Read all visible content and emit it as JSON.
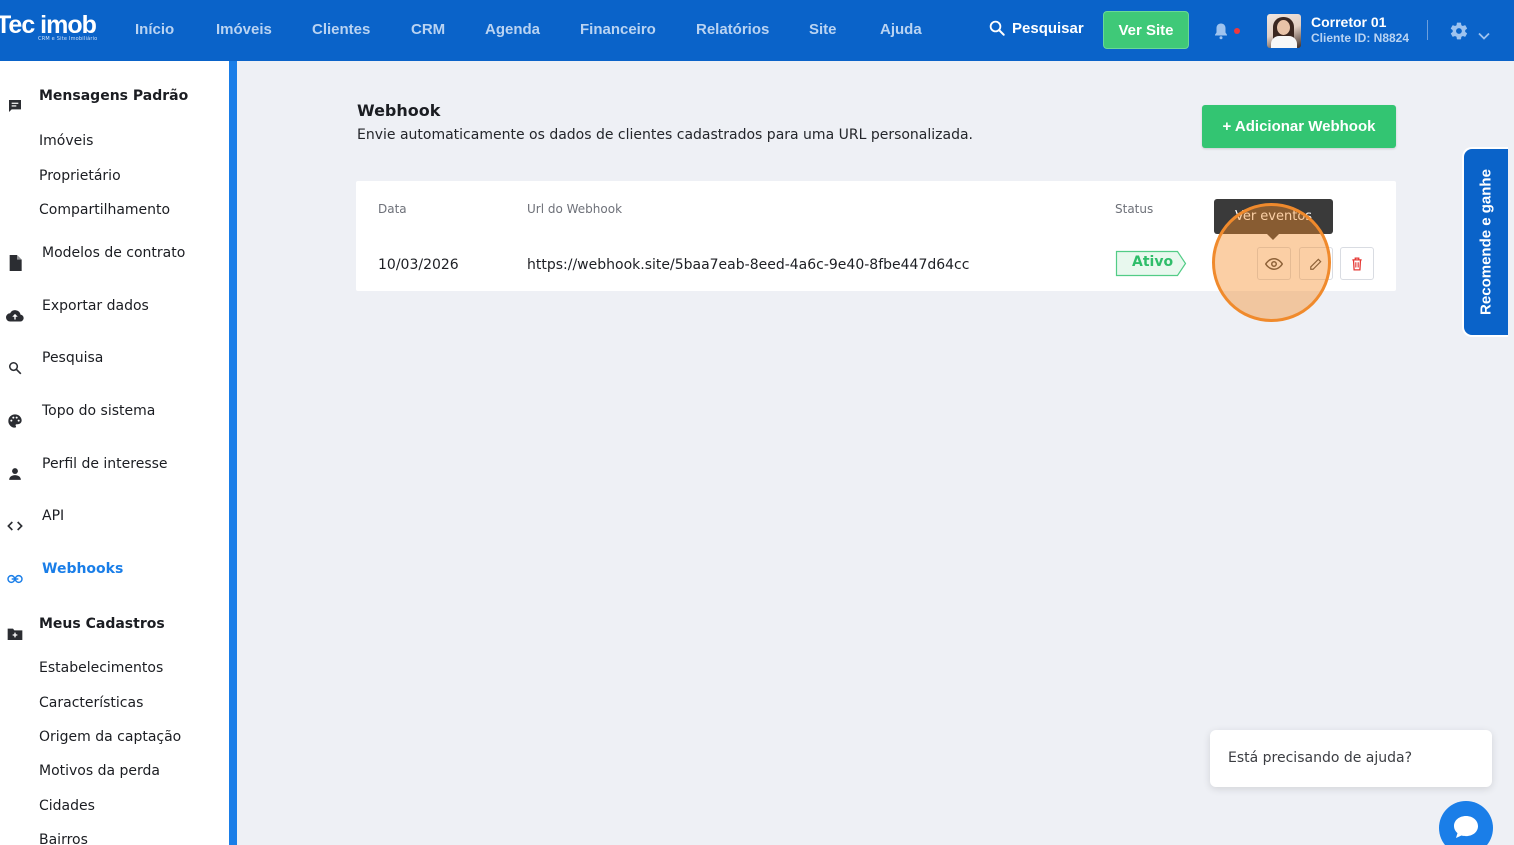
{
  "app": {
    "logo_text": "Tec imob",
    "logo_subtext": "CRM e Site Imobiliário"
  },
  "navbar": {
    "items": [
      "Início",
      "Imóveis",
      "Clientes",
      "CRM",
      "Agenda",
      "Financeiro",
      "Relatórios",
      "Site",
      "Ajuda"
    ],
    "search_label": "Pesquisar",
    "ver_site_label": "Ver Site",
    "user": {
      "name": "Corretor 01",
      "client_id": "Cliente ID: N8824"
    }
  },
  "sidebar": {
    "mensagens_padrao": {
      "label": "Mensagens Padrão",
      "items": [
        "Imóveis",
        "Proprietário",
        "Compartilhamento"
      ]
    },
    "items": [
      {
        "label": "Modelos de contrato",
        "icon": "file-icon"
      },
      {
        "label": "Exportar dados",
        "icon": "cloud-upload-icon"
      },
      {
        "label": "Pesquisa",
        "icon": "search-icon"
      },
      {
        "label": "Topo do sistema",
        "icon": "palette-icon"
      },
      {
        "label": "Perfil de interesse",
        "icon": "person-icon"
      },
      {
        "label": "API",
        "icon": "code-icon"
      },
      {
        "label": "Webhooks",
        "icon": "link-icon",
        "active": true
      }
    ],
    "meus_cadastros": {
      "label": "Meus Cadastros",
      "items": [
        "Estabelecimentos",
        "Características",
        "Origem da captação",
        "Motivos da perda",
        "Cidades",
        "Bairros"
      ]
    }
  },
  "main": {
    "title": "Webhook",
    "description": "Envie automaticamente os dados de clientes cadastrados para uma URL personalizada.",
    "add_button_label": "+ Adicionar Webhook",
    "table": {
      "headers": {
        "date": "Data",
        "url": "Url do Webhook",
        "status": "Status"
      },
      "rows": [
        {
          "date": "10/03/2026",
          "url": "https://webhook.site/5baa7eab-8eed-4a6c-9e40-8fbe447d64cc",
          "status": "Ativo"
        }
      ]
    },
    "tooltip": "Ver eventos"
  },
  "widgets": {
    "recommend_label": "Recomende e ganhe",
    "help_text": "Está precisando de ajuda?"
  },
  "colors": {
    "primary": "#0a63c9",
    "accent_green": "#33c572",
    "sidebar_active": "#1a7ee8",
    "highlight": "#f08a2c",
    "delete_red": "#e53935"
  }
}
